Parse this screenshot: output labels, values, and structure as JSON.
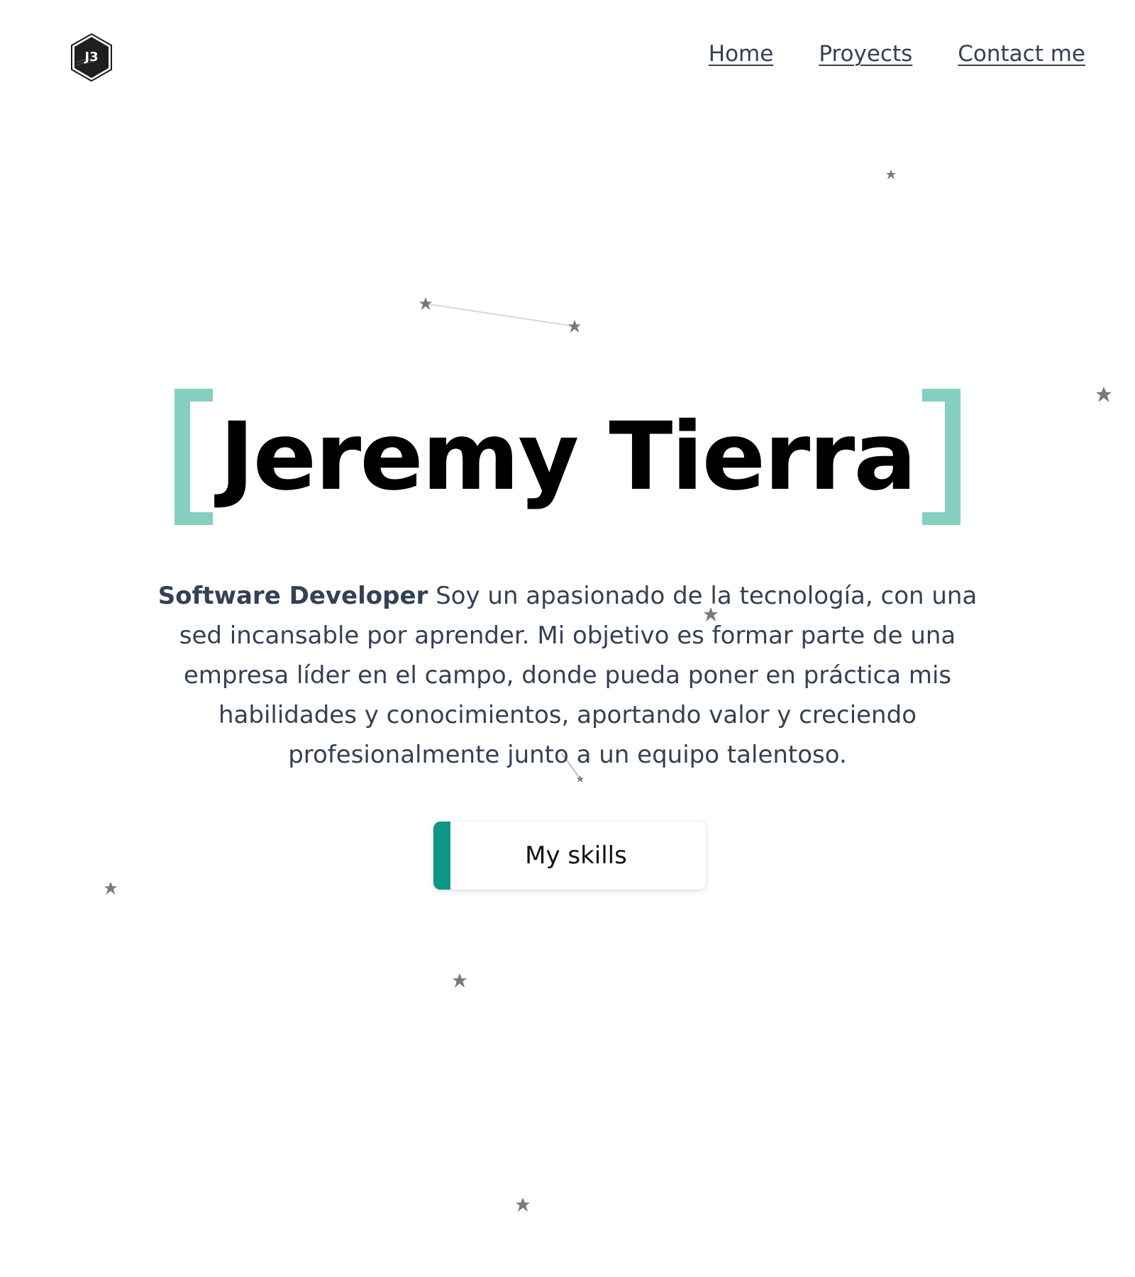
{
  "header": {
    "logo_text": "J3",
    "nav": [
      {
        "label": "Home"
      },
      {
        "label": "Proyects"
      },
      {
        "label": "Contact me"
      }
    ]
  },
  "hero": {
    "name": "Jeremy Tierra",
    "role": "Software Developer",
    "description": " Soy un apasionado de la tecnología, con una sed incansable por aprender. Mi objetivo es formar parte de una empresa líder en el campo, donde pueda poner en práctica mis habilidades y conocimientos, aportando valor y creciendo profesionalmente junto a un equipo talentoso.",
    "skills_button": "My skills"
  },
  "colors": {
    "bracket": "#85cfc1",
    "button_accent": "#0f9685",
    "text": "#334155",
    "star": "#7a7a7a"
  },
  "icons": {
    "logo": "hexagon-logo-icon",
    "star": "star-icon"
  }
}
